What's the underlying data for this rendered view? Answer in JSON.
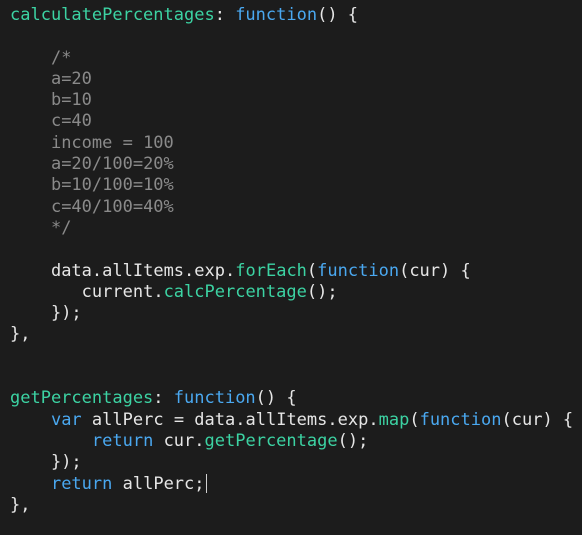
{
  "editor": {
    "theme": {
      "background": "#1c1c1c",
      "property": "#3cd3a3",
      "keyword": "#4aa8f0",
      "comment": "#8a8a8a",
      "text": "#e6e6e6"
    },
    "lines": [
      [
        [
          "prop",
          "calculatePercentages"
        ],
        [
          "punc",
          ": "
        ],
        [
          "kw",
          "function"
        ],
        [
          "punc",
          "() {"
        ]
      ],
      [],
      [
        [
          "ws",
          "    "
        ],
        [
          "comment",
          "/*"
        ]
      ],
      [
        [
          "ws",
          "    "
        ],
        [
          "comment",
          "a=20"
        ]
      ],
      [
        [
          "ws",
          "    "
        ],
        [
          "comment",
          "b=10"
        ]
      ],
      [
        [
          "ws",
          "    "
        ],
        [
          "comment",
          "c=40"
        ]
      ],
      [
        [
          "ws",
          "    "
        ],
        [
          "comment",
          "income = 100"
        ]
      ],
      [
        [
          "ws",
          "    "
        ],
        [
          "comment",
          "a=20/100=20%"
        ]
      ],
      [
        [
          "ws",
          "    "
        ],
        [
          "comment",
          "b=10/100=10%"
        ]
      ],
      [
        [
          "ws",
          "    "
        ],
        [
          "comment",
          "c=40/100=40%"
        ]
      ],
      [
        [
          "ws",
          "    "
        ],
        [
          "comment",
          "*/"
        ]
      ],
      [],
      [
        [
          "ws",
          "    "
        ],
        [
          "ident",
          "data"
        ],
        [
          "punc",
          "."
        ],
        [
          "ident",
          "allItems"
        ],
        [
          "punc",
          "."
        ],
        [
          "ident",
          "exp"
        ],
        [
          "punc",
          "."
        ],
        [
          "method",
          "forEach"
        ],
        [
          "punc",
          "("
        ],
        [
          "kw",
          "function"
        ],
        [
          "punc",
          "("
        ],
        [
          "param",
          "cur"
        ],
        [
          "punc",
          ") {"
        ]
      ],
      [
        [
          "ws",
          "       "
        ],
        [
          "ident",
          "current"
        ],
        [
          "punc",
          "."
        ],
        [
          "method",
          "calcPercentage"
        ],
        [
          "punc",
          "();"
        ]
      ],
      [
        [
          "ws",
          "    "
        ],
        [
          "punc",
          "});"
        ]
      ],
      [
        [
          "punc",
          "},"
        ]
      ],
      [],
      [],
      [
        [
          "prop",
          "getPercentages"
        ],
        [
          "punc",
          ": "
        ],
        [
          "kw",
          "function"
        ],
        [
          "punc",
          "() {"
        ]
      ],
      [
        [
          "ws",
          "    "
        ],
        [
          "kw",
          "var"
        ],
        [
          "punc",
          " "
        ],
        [
          "ident",
          "allPerc"
        ],
        [
          "punc",
          " = "
        ],
        [
          "ident",
          "data"
        ],
        [
          "punc",
          "."
        ],
        [
          "ident",
          "allItems"
        ],
        [
          "punc",
          "."
        ],
        [
          "ident",
          "exp"
        ],
        [
          "punc",
          "."
        ],
        [
          "method",
          "map"
        ],
        [
          "punc",
          "("
        ],
        [
          "kw",
          "function"
        ],
        [
          "punc",
          "("
        ],
        [
          "param",
          "cur"
        ],
        [
          "punc",
          ") {"
        ]
      ],
      [
        [
          "ws",
          "        "
        ],
        [
          "kw",
          "return"
        ],
        [
          "punc",
          " "
        ],
        [
          "ident",
          "cur"
        ],
        [
          "punc",
          "."
        ],
        [
          "method",
          "getPercentage"
        ],
        [
          "punc",
          "();"
        ]
      ],
      [
        [
          "ws",
          "    "
        ],
        [
          "punc",
          "});"
        ]
      ],
      [
        [
          "ws",
          "    "
        ],
        [
          "kw",
          "return"
        ],
        [
          "punc",
          " "
        ],
        [
          "ident",
          "allPerc"
        ],
        [
          "punc",
          ";"
        ],
        [
          "caret",
          ""
        ]
      ],
      [
        [
          "punc",
          "},"
        ]
      ]
    ]
  }
}
